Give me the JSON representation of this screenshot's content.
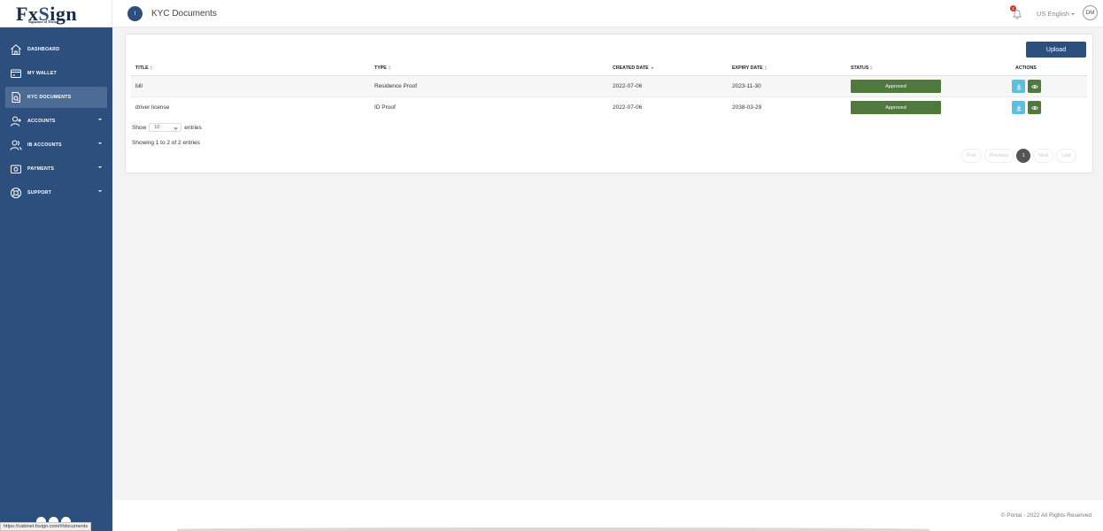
{
  "brand": {
    "logo_main_a": "Fx",
    "logo_main_b": "S",
    "logo_main_c": "ign",
    "tagline": "Signature of Trust"
  },
  "sidebar": {
    "items": [
      {
        "label": "DASHBOARD",
        "icon": "home-icon",
        "has_caret": false
      },
      {
        "label": "MY WALLET",
        "icon": "wallet-icon",
        "has_caret": false
      },
      {
        "label": "KYC DOCUMENTS",
        "icon": "document-search-icon",
        "has_caret": false,
        "active": true
      },
      {
        "label": "ACCOUNTS",
        "icon": "user-add-icon",
        "has_caret": true
      },
      {
        "label": "IB ACCOUNTS",
        "icon": "users-icon",
        "has_caret": true
      },
      {
        "label": "PAYMENTS",
        "icon": "payment-icon",
        "has_caret": true
      },
      {
        "label": "SUPPORT",
        "icon": "lifebuoy-icon",
        "has_caret": true
      }
    ],
    "status_url": "https://cabinet.fxsign.com/#/documents"
  },
  "header": {
    "page_number": "I",
    "title": "KYC Documents",
    "notification_count": "1",
    "language": "US English",
    "user_initials": "DM"
  },
  "table": {
    "upload_label": "Upload",
    "columns": [
      "TITLE",
      "TYPE",
      "CREATED DATE",
      "EXPIRY DATE",
      "STATUS",
      "ACTIONS"
    ],
    "rows": [
      {
        "title": "bill",
        "type": "Residence Proof",
        "created": "2022-07-06",
        "expiry": "2023-11-30",
        "status": "Approved"
      },
      {
        "title": "driver license",
        "type": "ID Proof",
        "created": "2022-07-06",
        "expiry": "2038-03-29",
        "status": "Approved"
      }
    ],
    "show_label": "Show",
    "entries_value": "10",
    "entries_label": "entries",
    "info": "Showing 1 to 2 of 2 entries",
    "pager": {
      "first": "First",
      "previous": "Previous",
      "current": "1",
      "next": "Next",
      "last": "Last"
    }
  },
  "footer": {
    "text": "© Portal - 2022 All Rights Reserved"
  },
  "colors": {
    "sidebar_bg": "#2c4f7e",
    "status_approved": "#4f7a3b",
    "download_button": "#5bc0de"
  }
}
